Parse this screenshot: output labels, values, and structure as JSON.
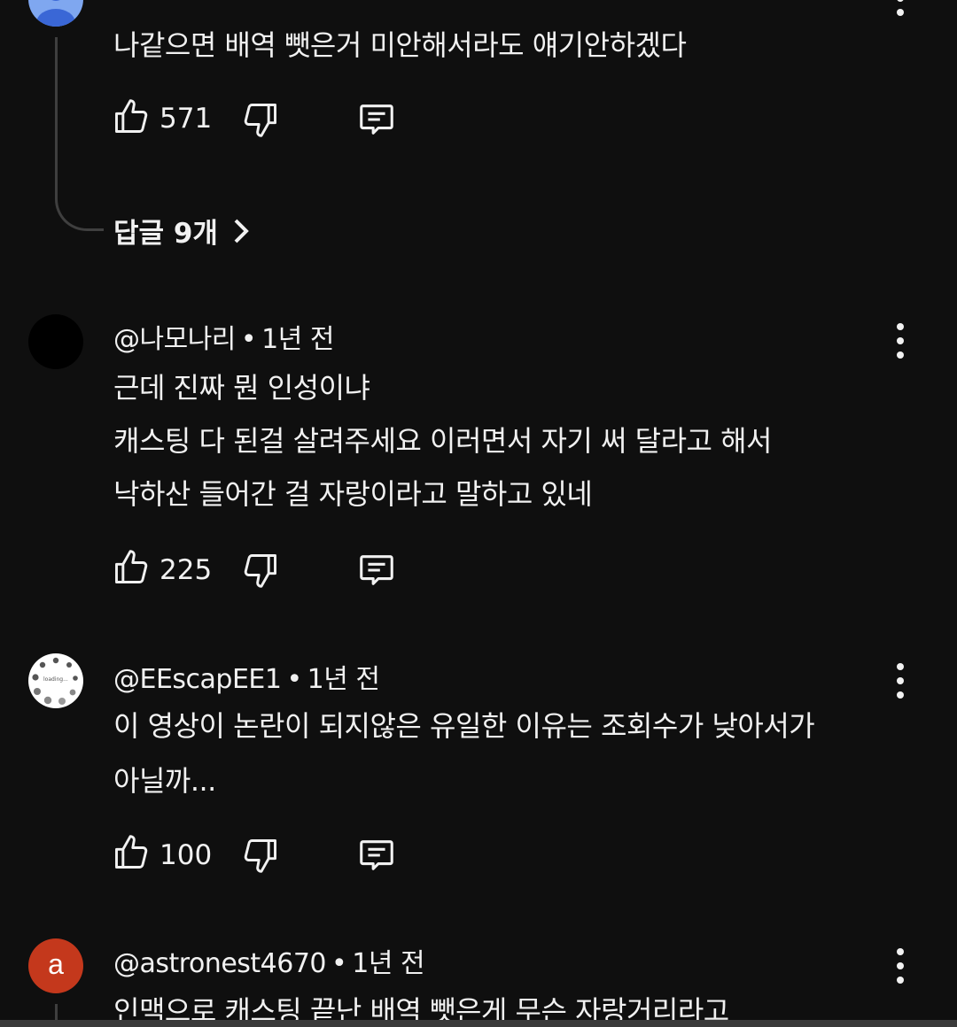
{
  "comments": [
    {
      "username": "",
      "time": "",
      "lines": [
        "나같으면 배역 뺏은거 미안해서라도 얘기안하겠다"
      ],
      "likes": "571",
      "avatar_icon": "default-person-avatar-icon",
      "avatar_color": "#7fa7f0",
      "replies_label": "답글 9개"
    },
    {
      "username": "@나모나리",
      "time": "1년 전",
      "lines": [
        "근데 진짜 뭔 인성이냐",
        "캐스팅 다 된걸 살려주세요  이러면서 자기 써 달라고 해서",
        "낙하산 들어간 걸 자랑이라고 말하고 있네"
      ],
      "likes": "225",
      "avatar_color": "#000000"
    },
    {
      "username": "@EEscapEE1",
      "time": "1년 전",
      "lines": [
        "이 영상이 논란이 되지않은 유일한 이유는 조회수가 낮아서가",
        "아닐까..."
      ],
      "likes": "100",
      "avatar_text": "loading...",
      "avatar_icon": "loading-spinner-avatar-icon",
      "avatar_color": "#ffffff"
    },
    {
      "username": "@astronest4670",
      "time": "1년 전",
      "lines": [
        "인맥으로 캐스팅 끝난 배역 뺏은게 무슨 자랑거리라고"
      ],
      "avatar_letter": "a",
      "avatar_color": "#c4381c"
    }
  ],
  "separator": "•",
  "icons": {
    "like": "thumbs-up-icon",
    "dislike": "thumbs-down-icon",
    "reply": "comment-reply-icon",
    "more": "more-vert-icon",
    "chevron": "chevron-right-icon"
  }
}
